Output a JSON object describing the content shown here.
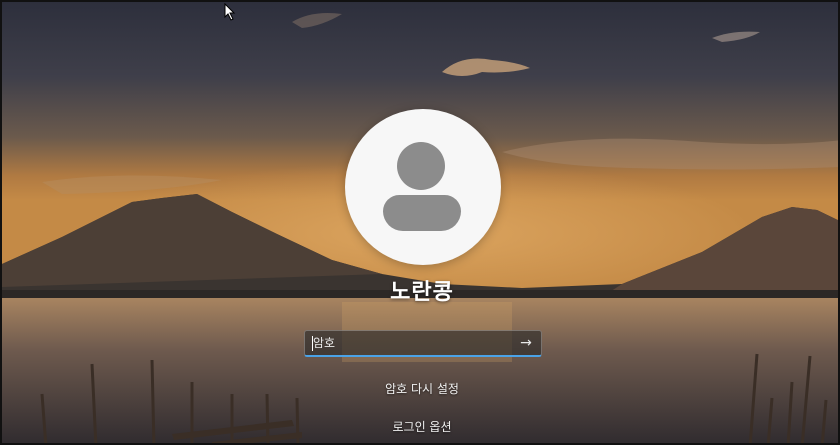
{
  "user": {
    "name": "노란콩"
  },
  "password": {
    "placeholder": "암호",
    "value": ""
  },
  "links": {
    "reset_password": "암호 다시 설정",
    "signin_options": "로그인 옵션"
  },
  "icons": {
    "submit": "arrow-right-icon",
    "avatar": "user-avatar-icon"
  },
  "colors": {
    "accent": "#4aa3e8"
  }
}
